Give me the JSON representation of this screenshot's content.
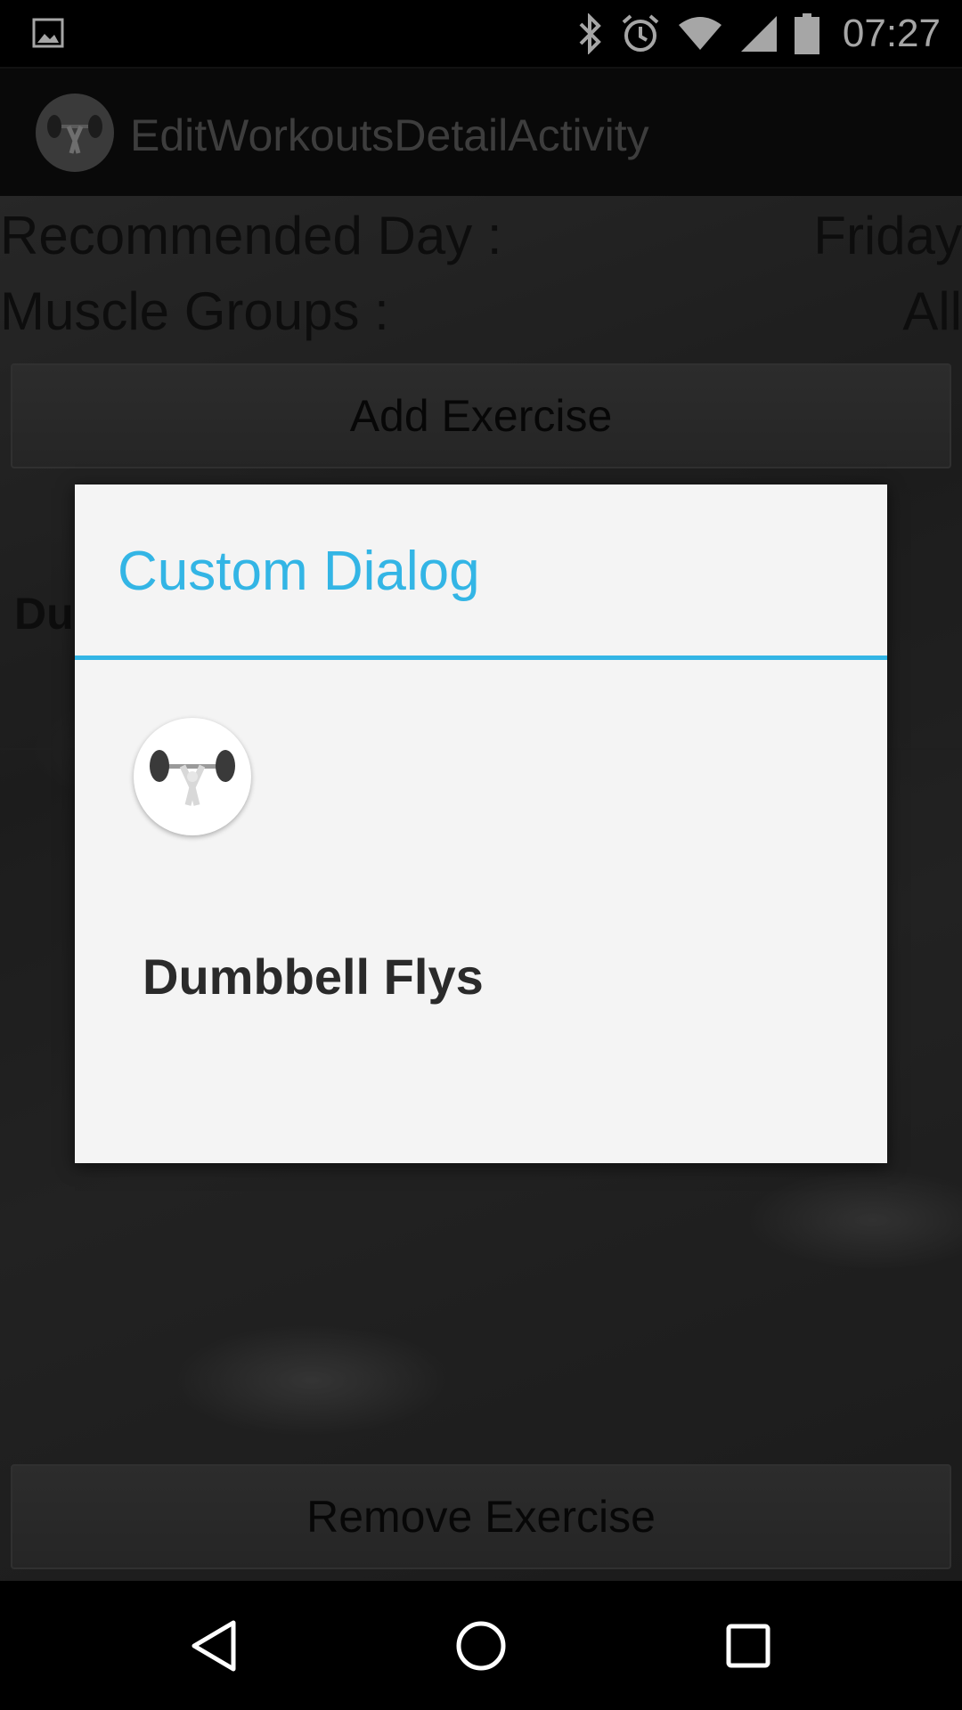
{
  "status_bar": {
    "time": "07:27",
    "icons": [
      "gallery-icon",
      "bluetooth-icon",
      "alarm-icon",
      "wifi-icon",
      "cellular-signal-icon",
      "battery-icon"
    ]
  },
  "action_bar": {
    "title": "EditWorkoutsDetailActivity",
    "logo_icon": "barbell-lifter-icon"
  },
  "details": {
    "recommended_day_label": "Recommended Day :",
    "recommended_day_value": "Friday",
    "muscle_groups_label": "Muscle Groups :",
    "muscle_groups_value": "All"
  },
  "buttons": {
    "add_exercise": "Add Exercise",
    "remove_exercise": "Remove Exercise"
  },
  "list": {
    "peek_text": "Du"
  },
  "dialog": {
    "title": "Custom Dialog",
    "icon": "barbell-lifter-icon",
    "exercise_name": "Dumbbell Flys",
    "accent_color": "#33b5e5"
  },
  "nav_bar": {
    "icons": [
      "back-icon",
      "home-icon",
      "recents-icon"
    ]
  }
}
